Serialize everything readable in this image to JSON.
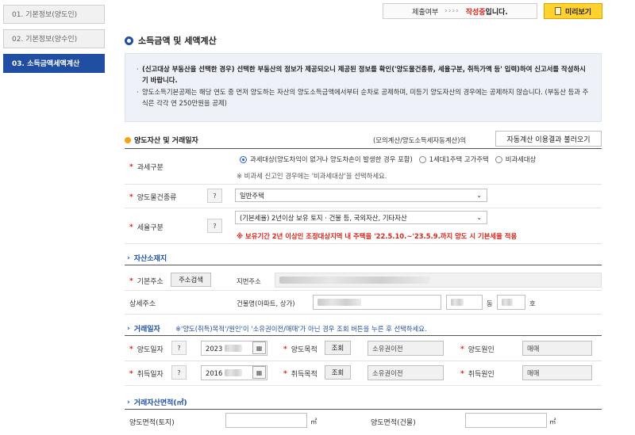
{
  "steps": [
    {
      "label": "01. 기본정보(양도인)"
    },
    {
      "label": "02. 기본정보(양수인)"
    },
    {
      "label": "03. 소득금액세액계산"
    }
  ],
  "status": {
    "prefix": "제출여부",
    "arrows": "››››",
    "state": "작성중",
    "suffix": "입니다."
  },
  "preview_button": "미리보기",
  "section_title": "소득금액 및 세액계산",
  "notice": {
    "line1": "(신고대상 부동산을 선택한 경우) 선택한 부동산의 정보가 제공되오니 제공된 정보를 확인('양도물건종류, 세율구분, 취득가액 등' 입력)하여 신고서를 작성하시기 바랍니다.",
    "line2": "양도소득기본공제는 해당 연도 중 먼저 양도하는 자산의 양도소득금액에서부터 순차로 공제하며, 미등기 양도자산의 경우에는 공제하지 않습니다. (부동산 등과 주식은 각각 연 250만원을 공제)"
  },
  "asset": {
    "title": "양도자산 및 거래일자",
    "calc_note": "(모의계산/양도소득세자동계산)의",
    "load_button": "자동계산 이용결과 불러오기",
    "tax_type_label": "과세구분",
    "tax_options": [
      "과세대상(양도차익이 없거나 양도차손이 발생한 경우 포함)",
      "1세대1주택 고가주택",
      "비과세대상"
    ],
    "tax_hint": "※ 비과세 신고인 경우에는 '비과세대상'을 선택하세요.",
    "property_label": "양도물건종류",
    "property_value": "일반주택",
    "rate_label": "세율구분",
    "rate_value": "(기본세율) 2년이상 보유 토지 · 건물 등, 국외자산, 기타자산",
    "rate_warning": "※ 보유기간 2년 이상인 조정대상지역 내 주택을 '22.5.10.~'23.5.9.까지 양도 시 기본세율 적용",
    "help": "?",
    "required": "*"
  },
  "location": {
    "title": "자산소재지",
    "basic_label": "기본주소",
    "search_button": "주소검색",
    "lot_label": "지번주소",
    "detail_label": "상세주소",
    "building_label": "건물명(아파트, 상가)",
    "dong": "동",
    "ho": "호"
  },
  "trade": {
    "title": "거래일자",
    "note": "※'양도(취득)목적'/원인'이 '소유권이전/매매'가 아닌 경우 조회 버튼을 누른 후 선택하세요.",
    "sale_date_label": "양도일자",
    "sale_date": "2023",
    "sale_purpose_label": "양도목적",
    "search": "조회",
    "sale_purpose": "소유권이전",
    "sale_cause_label": "양도원인",
    "sale_cause": "매매",
    "acq_date_label": "취득일자",
    "acq_date": "2016",
    "acq_purpose_label": "취득목적",
    "acq_purpose": "소유권이전",
    "acq_cause_label": "취득원인",
    "acq_cause": "매매",
    "calendar_icon": "calendar-icon"
  },
  "area": {
    "title": "거래자산면적(㎡)",
    "land_label": "양도면적(토지)",
    "building_label": "양도면적(건물)",
    "unit": "㎡"
  }
}
